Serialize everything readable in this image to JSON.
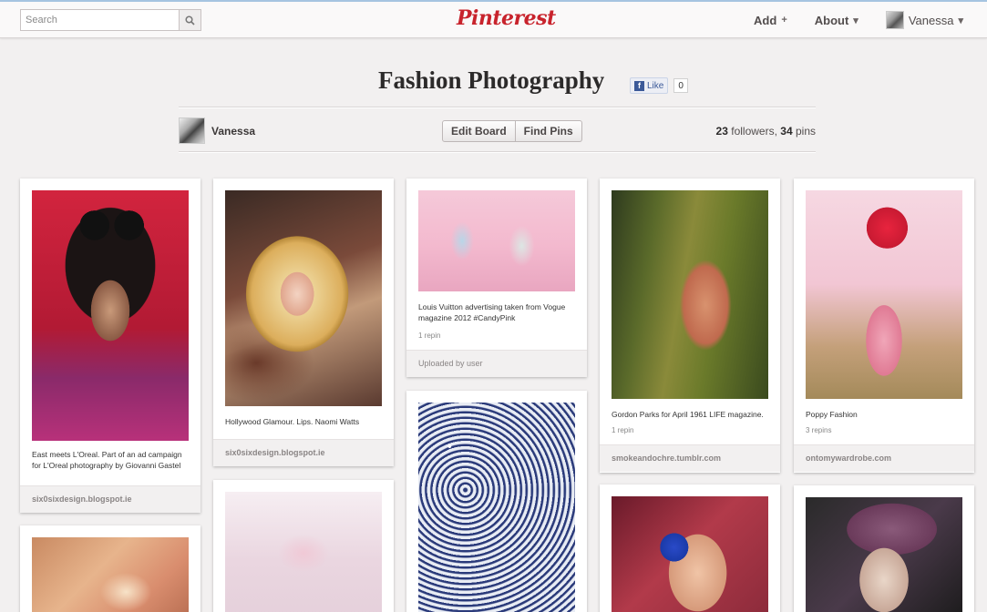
{
  "search": {
    "placeholder": "Search"
  },
  "logo": "Pinterest",
  "nav": {
    "add": "Add",
    "about": "About",
    "user": "Vanessa"
  },
  "board": {
    "title": "Fashion Photography",
    "fb_like": "Like",
    "fb_count": "0",
    "owner": "Vanessa",
    "edit_board": "Edit Board",
    "find_pins": "Find Pins",
    "followers": "23",
    "followers_label": "followers,",
    "pins": "34",
    "pins_label": "pins"
  },
  "pins": [
    {
      "desc": "East meets L'Oreal. Part of an ad campaign for L'Oreal photography by Giovanni Gastel",
      "footer": "six0sixdesign.blogspot.ie"
    },
    {
      "desc": "Hollywood Glamour. Lips. Naomi Watts",
      "footer": "six0sixdesign.blogspot.ie"
    },
    {
      "desc": "Louis Vuitton advertising taken from Vogue magazine 2012 #CandyPink",
      "repins": "1 repin",
      "footer": "Uploaded by user"
    },
    {
      "desc": "Gordon Parks for April 1961 LIFE magazine.",
      "repins": "1 repin",
      "footer": "smokeandochre.tumblr.com"
    },
    {
      "desc": "Poppy Fashion",
      "repins": "3 repins",
      "footer": "ontomywardrobe.com"
    }
  ],
  "colors": {
    "brand": "#c8232c",
    "background": "#f2f0f0"
  }
}
